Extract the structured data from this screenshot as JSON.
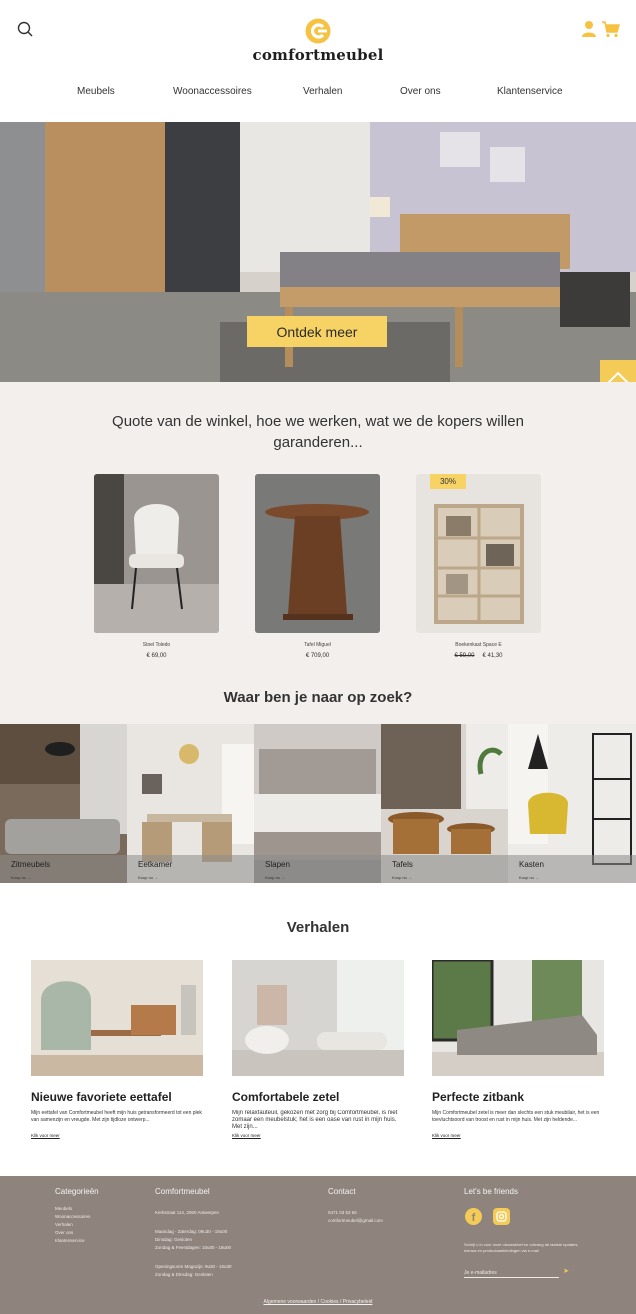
{
  "brand": {
    "name": "comfortmeubel",
    "accent": "#f7d365"
  },
  "header": {
    "icons": {
      "search": "search-icon",
      "user": "user-icon",
      "cart": "cart-icon"
    },
    "nav": [
      "Meubels",
      "Woonaccessoires",
      "Verhalen",
      "Over ons",
      "Klantenservice"
    ]
  },
  "hero": {
    "cta_label": "Ontdek meer"
  },
  "quote": "Quote van de winkel, hoe we werken, wat we de kopers willen garanderen...",
  "products": [
    {
      "name": "Stoel Toledo",
      "price": "€ 69,00",
      "old_price": "",
      "badge": ""
    },
    {
      "name": "Tafel Miguel",
      "price": "€ 709,00",
      "old_price": "",
      "badge": ""
    },
    {
      "name": "Boekenkast Space E",
      "price": "€ 41,30",
      "old_price": "€ 59,00",
      "badge": "30%"
    }
  ],
  "categories_title": "Waar ben je naar op zoek?",
  "categories": [
    {
      "label": "Zitmeubels",
      "link": "Koop nu →"
    },
    {
      "label": "Eetkamer",
      "link": "Koop nu →"
    },
    {
      "label": "Slapen",
      "link": "Koop nu →"
    },
    {
      "label": "Tafels",
      "link": "Koop nu →"
    },
    {
      "label": "Kasten",
      "link": "Koop nu →"
    }
  ],
  "stories_title": "Verhalen",
  "stories": [
    {
      "title": "Nieuwe favoriete eettafel",
      "text": "Mijn eettafel van Comfortmeubel heeft mijn huis getransformeerd tot een plek van samenzijn en vreugde. Met zijn tijdloze ontwerp...",
      "link": "Klik voor meer"
    },
    {
      "title": "Comfortabele zetel",
      "text": "Mijn relaxfauteuil, gekozen met zorg bij Comfortmeubel, is niet zomaar een meubelstuk; het is een oase van rust in mijn huis. Met zijn...",
      "link": "Klik voor meer"
    },
    {
      "title": "Perfecte zitbank",
      "text": "Mijn Comfortmeubel zetel is meer dan slechts een stuk meubilair, het is een toevluchtsoord van troost en rust in mijn huis. Met zijn heldende...",
      "link": "Klik voor meer"
    }
  ],
  "footer": {
    "categories": {
      "heading": "Categorieën",
      "items": [
        "Meubels",
        "Woonaccessoires",
        "Verhalen",
        "Over ons",
        "Klantenservice"
      ]
    },
    "company": {
      "heading": "Comfortmeubel",
      "address": "Kerkstraat 114, 2060 Antwerpen",
      "hours": [
        "Maandag - Zaterdag: 09u30 - 18u00",
        "Dinsdag: Gesloten",
        "Zondag & Feestdagen: 10u00 - 18u00"
      ],
      "warehouse": [
        "Openingsuren Magazijn: 9u30 - 16u30",
        "Zondag & Dinsdag: Gesloten"
      ]
    },
    "contact": {
      "heading": "Contact",
      "phone": "0471 03 53 65",
      "email": "comfortmeubel@gmail.com"
    },
    "social": {
      "heading": "Let's be friends",
      "icons": [
        "facebook-icon",
        "instagram-icon"
      ]
    },
    "newsletter": {
      "text": "Schrijf u in voor onze nieuwsbrief en ontvang de laatste updates, nieuws en productaanbiedingen via e-mail",
      "placeholder": "Je e-mailadres"
    },
    "legal": "Algemene voorwaarden / Cookies / Privacybeleid"
  }
}
